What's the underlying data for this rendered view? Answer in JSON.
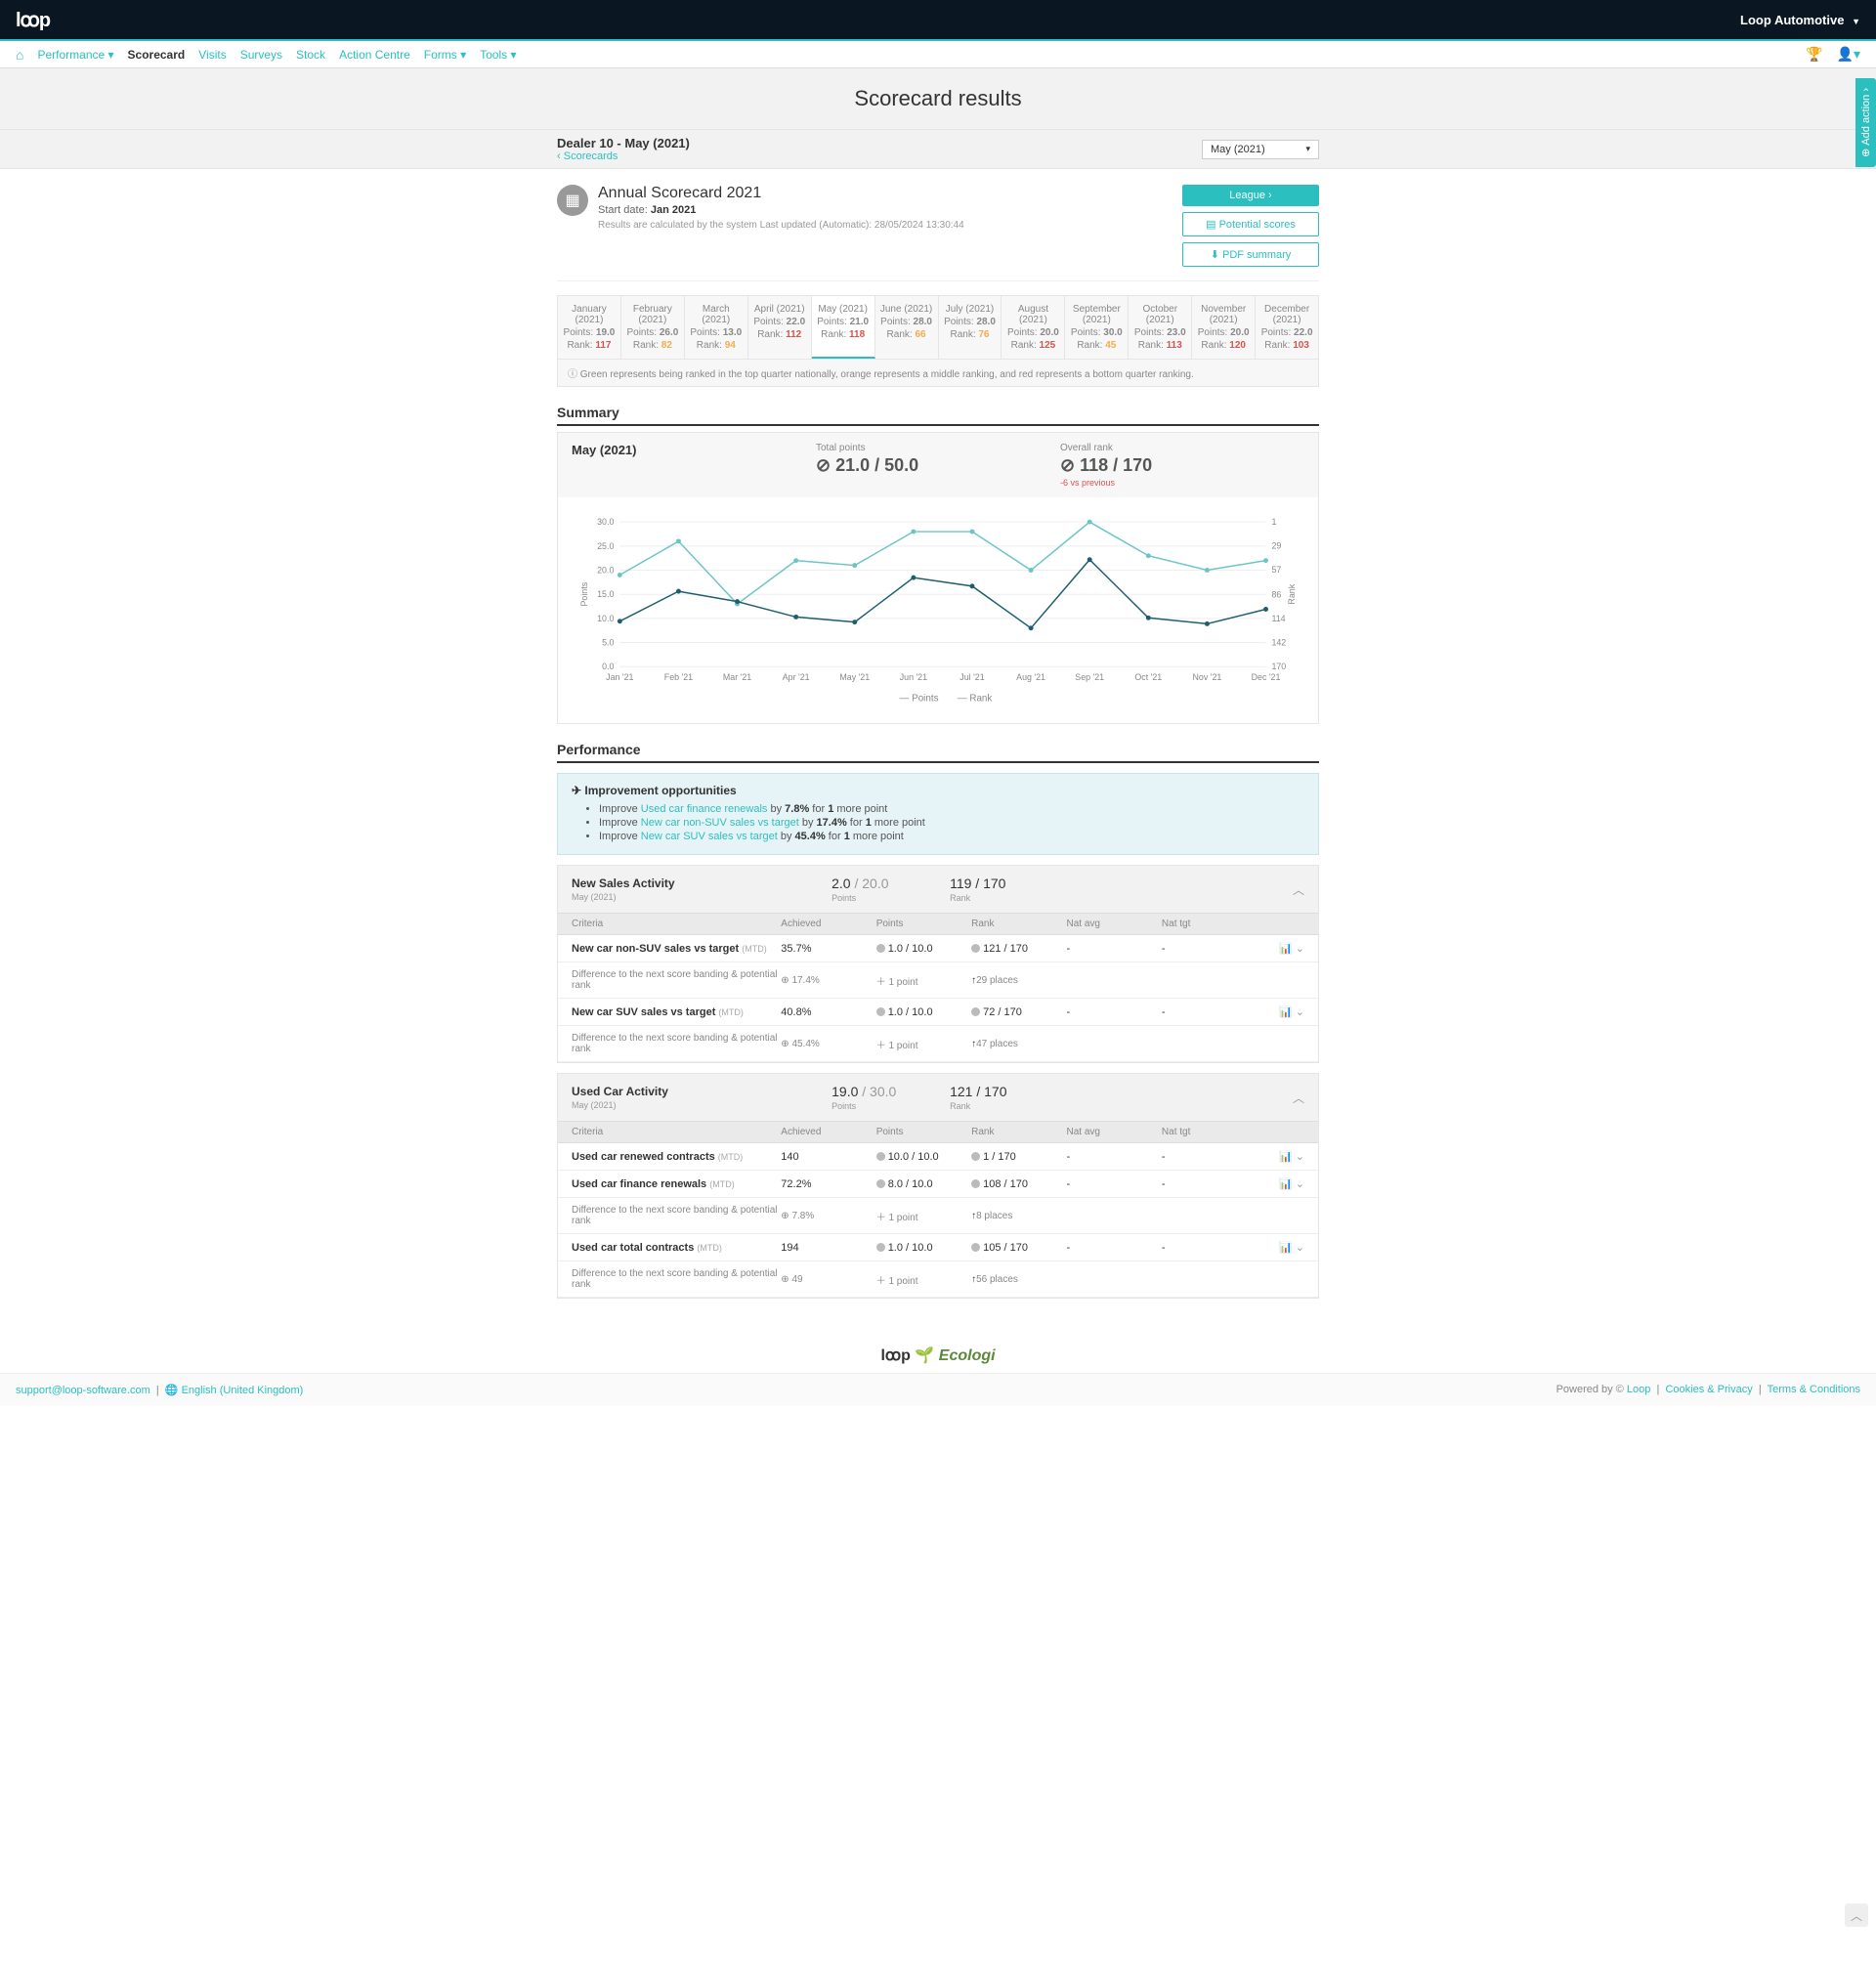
{
  "tenant": "Loop Automotive",
  "nav": {
    "items": [
      "Performance",
      "Scorecard",
      "Visits",
      "Surveys",
      "Stock",
      "Action Centre",
      "Forms",
      "Tools"
    ],
    "active": "Scorecard"
  },
  "page_title": "Scorecard results",
  "dealer_title": "Dealer 10 - May (2021)",
  "breadcrumb": "Scorecards",
  "month_selector": "May (2021)",
  "scorecard": {
    "title": "Annual Scorecard 2021",
    "start_label": "Start date:",
    "start_date": "Jan 2021",
    "calc_text": "Results are calculated by the system",
    "updated": "Last updated (Automatic): 28/05/2024 13:30:44",
    "buttons": {
      "league": "League",
      "potential": "Potential scores",
      "pdf": "PDF summary"
    }
  },
  "month_tabs": [
    {
      "label": "January (2021)",
      "points": "19.0",
      "rank": "117",
      "rank_class": "rank-red"
    },
    {
      "label": "February (2021)",
      "points": "26.0",
      "rank": "82",
      "rank_class": "rank-orange"
    },
    {
      "label": "March (2021)",
      "points": "13.0",
      "rank": "94",
      "rank_class": "rank-orange"
    },
    {
      "label": "April (2021)",
      "points": "22.0",
      "rank": "112",
      "rank_class": "rank-red"
    },
    {
      "label": "May (2021)",
      "points": "21.0",
      "rank": "118",
      "rank_class": "rank-red",
      "active": true
    },
    {
      "label": "June (2021)",
      "points": "28.0",
      "rank": "66",
      "rank_class": "rank-orange"
    },
    {
      "label": "July (2021)",
      "points": "28.0",
      "rank": "76",
      "rank_class": "rank-orange"
    },
    {
      "label": "August (2021)",
      "points": "20.0",
      "rank": "125",
      "rank_class": "rank-red"
    },
    {
      "label": "September (2021)",
      "points": "30.0",
      "rank": "45",
      "rank_class": "rank-orange"
    },
    {
      "label": "October (2021)",
      "points": "23.0",
      "rank": "113",
      "rank_class": "rank-red"
    },
    {
      "label": "November (2021)",
      "points": "20.0",
      "rank": "120",
      "rank_class": "rank-red"
    },
    {
      "label": "December (2021)",
      "points": "22.0",
      "rank": "103",
      "rank_class": "rank-red"
    }
  ],
  "legend_note": "Green represents being ranked in the top quarter nationally, orange represents a middle ranking, and red represents a bottom quarter ranking.",
  "summary": {
    "title": "Summary",
    "month": "May (2021)",
    "total_label": "Total points",
    "total_value": "21.0 / 50.0",
    "rank_label": "Overall rank",
    "rank_value": "118 / 170",
    "delta": "-6 vs previous"
  },
  "chart_data": {
    "type": "line",
    "categories": [
      "Jan '21",
      "Feb '21",
      "Mar '21",
      "Apr '21",
      "May '21",
      "Jun '21",
      "Jul '21",
      "Aug '21",
      "Sep '21",
      "Oct '21",
      "Nov '21",
      "Dec '21"
    ],
    "series": [
      {
        "name": "Points",
        "values": [
          19,
          26,
          13,
          22,
          21,
          28,
          28,
          20,
          30,
          23,
          20,
          22
        ],
        "axis": "left",
        "color": "#6cc5c5"
      },
      {
        "name": "Rank",
        "values": [
          117,
          82,
          94,
          112,
          118,
          66,
          76,
          125,
          45,
          113,
          120,
          103
        ],
        "axis": "right",
        "color": "#1d5e6e"
      }
    ],
    "y_left": {
      "min": 0,
      "max": 30,
      "step": 5,
      "label": "Points"
    },
    "y_right": {
      "ticks": [
        1,
        29,
        57,
        86,
        114,
        142,
        170
      ],
      "label": "Rank"
    },
    "legend": [
      "Points",
      "Rank"
    ]
  },
  "performance": {
    "title": "Performance",
    "improve": {
      "title": "Improvement opportunities",
      "items": [
        {
          "prefix": "Improve ",
          "link": "Used car finance renewals",
          "pct": "7.8%",
          "tail": " for ",
          "count": "1",
          "tail2": " more point"
        },
        {
          "prefix": "Improve ",
          "link": "New car non-SUV sales vs target",
          "pct": "17.4%",
          "tail": " for ",
          "count": "1",
          "tail2": " more point"
        },
        {
          "prefix": "Improve ",
          "link": "New car SUV sales vs target",
          "pct": "45.4%",
          "tail": " for ",
          "count": "1",
          "tail2": " more point"
        }
      ]
    },
    "columns": {
      "criteria": "Criteria",
      "achieved": "Achieved",
      "points": "Points",
      "rank": "Rank",
      "natavg": "Nat avg",
      "nattgt": "Nat tgt"
    },
    "diff_label": "Difference to the next score banding & potential rank",
    "panels": [
      {
        "title": "New Sales Activity",
        "sub": "May (2021)",
        "points": "2.0",
        "points_denom": "/ 20.0",
        "points_label": "Points",
        "rank": "119 / 170",
        "rank_label": "Rank",
        "rows": [
          {
            "name": "New car non-SUV sales vs target",
            "mtd": "(MTD)",
            "achieved": "35.7%",
            "points": "1.0 / 10.0",
            "rank": "121 / 170",
            "natavg": "-",
            "nattgt": "-",
            "diff": {
              "achieved": "17.4%",
              "points": "1 point",
              "rank": "29 places"
            }
          },
          {
            "name": "New car SUV sales vs target",
            "mtd": "(MTD)",
            "achieved": "40.8%",
            "points": "1.0 / 10.0",
            "rank": "72 / 170",
            "natavg": "-",
            "nattgt": "-",
            "diff": {
              "achieved": "45.4%",
              "points": "1 point",
              "rank": "47 places"
            }
          }
        ]
      },
      {
        "title": "Used Car Activity",
        "sub": "May (2021)",
        "points": "19.0",
        "points_denom": "/ 30.0",
        "points_label": "Points",
        "rank": "121 / 170",
        "rank_label": "Rank",
        "rows": [
          {
            "name": "Used car renewed contracts",
            "mtd": "(MTD)",
            "achieved": "140",
            "points": "10.0 / 10.0",
            "rank": "1 / 170",
            "natavg": "-",
            "nattgt": "-"
          },
          {
            "name": "Used car finance renewals",
            "mtd": "(MTD)",
            "achieved": "72.2%",
            "points": "8.0 / 10.0",
            "rank": "108 / 170",
            "natavg": "-",
            "nattgt": "-",
            "diff": {
              "achieved": "7.8%",
              "points": "1 point",
              "rank": "8 places"
            }
          },
          {
            "name": "Used car total contracts",
            "mtd": "(MTD)",
            "achieved": "194",
            "points": "1.0 / 10.0",
            "rank": "105 / 170",
            "natavg": "-",
            "nattgt": "-",
            "diff": {
              "achieved": "49",
              "points": "1 point",
              "rank": "56 places"
            }
          }
        ]
      }
    ]
  },
  "footer": {
    "email": "support@loop-software.com",
    "lang": "English (United Kingdom)",
    "powered": "Powered by ©",
    "loop": "Loop",
    "cookies": "Cookies & Privacy",
    "terms": "Terms & Conditions"
  },
  "side_tab": "Add action"
}
